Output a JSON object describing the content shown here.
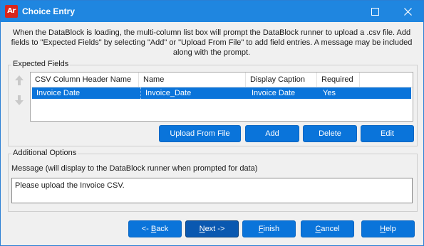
{
  "window": {
    "title": "Choice Entry",
    "logo_text": "Ar"
  },
  "description": "When the DataBlock is loading, the multi-column list box will prompt the DataBlock runner to upload a .csv file. Add fields to \"Expected Fields\" by selecting \"Add\" or \"Upload From File\" to add field entries. A message may be included along with the prompt.",
  "expected_fields": {
    "label": "Expected Fields",
    "columns": [
      "CSV Column Header Name",
      "Name",
      "Display Caption",
      "Required"
    ],
    "rows": [
      [
        "Invoice Date",
        "Invoice_Date",
        "Invoice Date",
        "Yes"
      ]
    ],
    "buttons": {
      "upload": "Upload From File",
      "add": "Add",
      "delete": "Delete",
      "edit": "Edit"
    }
  },
  "additional_options": {
    "label": "Additional Options",
    "message_label": "Message (will display to the DataBlock runner when prompted for data)",
    "message_value": "Please upload the Invoice CSV."
  },
  "footer": {
    "back": {
      "pre": "<- ",
      "key": "B",
      "post": "ack"
    },
    "next": {
      "pre": "",
      "key": "N",
      "post": "ext ->"
    },
    "finish": {
      "pre": "",
      "key": "F",
      "post": "inish"
    },
    "cancel": {
      "pre": "",
      "key": "C",
      "post": "ancel"
    },
    "help": {
      "pre": "",
      "key": "H",
      "post": "elp"
    }
  },
  "colors": {
    "titlebar": "#1f86e0",
    "accent": "#0a74da",
    "logo": "#d9261c"
  },
  "icons": [
    "app-logo-icon",
    "maximize-icon",
    "close-icon",
    "arrow-up-icon",
    "arrow-down-icon"
  ]
}
